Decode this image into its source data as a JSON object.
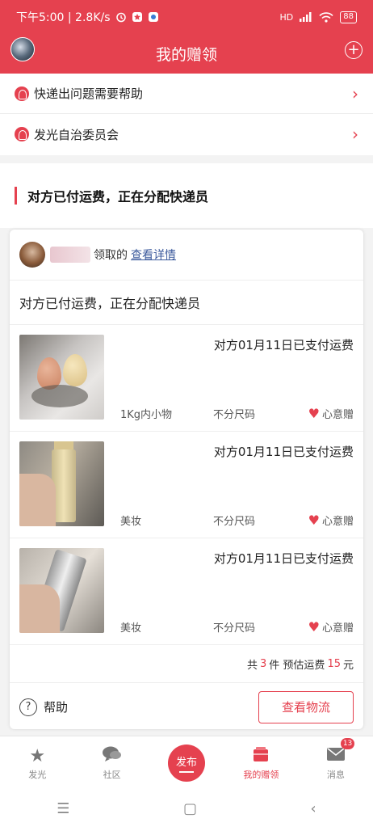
{
  "status_bar": {
    "time_speed": "下午5:00 | 2.8K/s",
    "network": "HD",
    "battery": "88"
  },
  "nav": {
    "title": "我的赠领",
    "add_symbol": "+"
  },
  "help_list": [
    {
      "label": "快递出问题需要帮助",
      "icon": "help-person-icon"
    },
    {
      "label": "发光自治委员会",
      "icon": "committee-icon"
    }
  ],
  "status_heading": "对方已付运费，正在分配快递员",
  "card": {
    "claim_text": "领取的",
    "detail_link": "查看详情",
    "status_text": "对方已付运费，正在分配快递员",
    "items": [
      {
        "paid": "对方01月11日已支付运费",
        "category": "1Kg内小物",
        "size": "不分尺码",
        "type": "心意赠"
      },
      {
        "paid": "对方01月11日已支付运费",
        "category": "美妆",
        "size": "不分尺码",
        "type": "心意赠"
      },
      {
        "paid": "对方01月11日已支付运费",
        "category": "美妆",
        "size": "不分尺码",
        "type": "心意赠"
      }
    ],
    "summary": {
      "prefix": "共",
      "count": "3",
      "count_unit": "件 预估运费",
      "fee": "15",
      "fee_unit": "元"
    },
    "help_label": "帮助",
    "logistics_button": "查看物流"
  },
  "tabs": [
    {
      "label": "发光",
      "icon": "star-icon"
    },
    {
      "label": "社区",
      "icon": "chat-icon"
    },
    {
      "label": "发布",
      "icon": "publish-icon"
    },
    {
      "label": "我的赠领",
      "icon": "gift-box-icon",
      "active": true
    },
    {
      "label": "消息",
      "icon": "mail-icon",
      "badge": "13"
    }
  ],
  "colors": {
    "accent": "#e5414f",
    "link": "#3c5a9c"
  }
}
